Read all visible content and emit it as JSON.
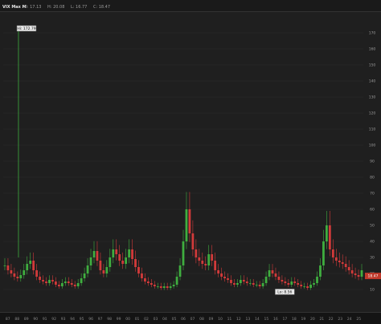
{
  "title_bar": {
    "symbol": "VIX Max M",
    "fields": [
      "O: 17.13",
      "H: 20.08",
      "L: 16.77",
      "C: 18.47"
    ]
  },
  "colors": {
    "up": "#3fae3f",
    "down": "#d23a3a",
    "background": "#1f1f1f",
    "last_price_badge": "#c0392b"
  },
  "chart_data": {
    "type": "candlestick",
    "y_ticks": [
      10,
      20,
      30,
      40,
      50,
      60,
      70,
      80,
      90,
      100,
      110,
      120,
      130,
      140,
      150,
      160,
      170
    ],
    "x_ticks": [
      "87",
      "88",
      "89",
      "90",
      "91",
      "92",
      "93",
      "94",
      "95",
      "96",
      "97",
      "98",
      "99",
      "00",
      "01",
      "02",
      "03",
      "04",
      "05",
      "06",
      "07",
      "08",
      "09",
      "10",
      "11",
      "12",
      "13",
      "14",
      "15",
      "16",
      "17",
      "18",
      "19",
      "20",
      "21",
      "22",
      "23",
      "24",
      "25"
    ],
    "ylim": [
      0,
      180
    ],
    "series": [
      {
        "values": [
          25,
          22,
          20,
          18,
          17,
          19,
          22,
          26,
          28,
          22,
          18,
          16,
          15,
          14,
          16,
          15,
          13,
          12,
          14,
          15,
          14,
          13,
          12,
          14,
          17,
          20,
          25,
          30,
          34,
          28,
          22,
          20,
          24,
          30,
          35,
          32,
          28,
          26,
          30,
          35,
          29,
          24,
          20,
          17,
          15,
          14,
          13,
          12,
          12,
          11,
          12,
          11,
          12,
          13,
          18,
          25,
          40,
          60,
          45,
          35,
          30,
          28,
          26,
          25,
          32,
          28,
          22,
          20,
          18,
          17,
          16,
          14,
          13,
          14,
          16,
          15,
          14,
          14,
          13,
          13,
          12,
          14,
          18,
          22,
          20,
          18,
          16,
          15,
          14,
          13,
          15,
          14,
          13,
          12,
          12,
          11,
          13,
          14,
          18,
          25,
          40,
          50,
          35,
          30,
          28,
          27,
          26,
          24,
          22,
          20,
          19,
          18,
          22
        ]
      }
    ],
    "annotations": [
      {
        "text": "Hi: 172.79",
        "x": "87",
        "y": 172.79
      },
      {
        "text": "Lo: 8.56",
        "x": "17",
        "y": 8.56
      }
    ],
    "last_price": "18.47"
  }
}
